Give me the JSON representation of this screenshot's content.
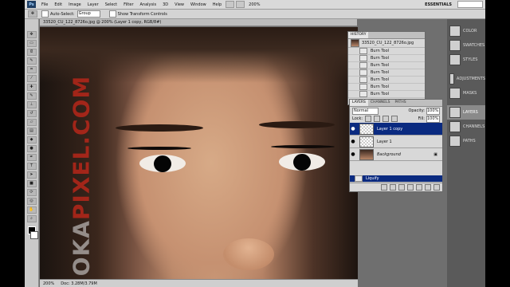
{
  "menubar": {
    "logo": "Ps",
    "items": [
      "File",
      "Edit",
      "Image",
      "Layer",
      "Select",
      "Filter",
      "Analysis",
      "3D",
      "View",
      "Window",
      "Help"
    ],
    "zoom": "200%",
    "workspace": "ESSENTIALS"
  },
  "options": {
    "auto_select_label": "Auto-Select:",
    "auto_select_value": "Group",
    "show_transform_label": "Show Transform Controls"
  },
  "document": {
    "tab_title": "33520_CU_122_8726o.jpg @ 200% (Layer 1 copy, RGB/8#)",
    "watermark_a": "OKA",
    "watermark_b": "PIXEL.COM",
    "status_zoom": "200%",
    "status_doc": "Doc: 3.28M/3.79M"
  },
  "history": {
    "tab_label": "HISTORY",
    "snapshot_label": "33520_CU_122_8726o.jpg",
    "steps": [
      "Burn Tool",
      "Burn Tool",
      "Burn Tool",
      "Burn Tool",
      "Burn Tool",
      "Burn Tool",
      "Burn Tool"
    ],
    "last_step": "Liquify"
  },
  "layers": {
    "tabs": [
      "LAYERS",
      "CHANNELS",
      "PATHS"
    ],
    "blend_mode": "Normal",
    "opacity_label": "Opacity:",
    "opacity_value": "100%",
    "lock_label": "Lock:",
    "fill_label": "Fill:",
    "fill_value": "100%",
    "items": [
      "Layer 1 copy",
      "Layer 1",
      "Background"
    ]
  },
  "dock": {
    "items": [
      "COLOR",
      "SWATCHES",
      "STYLES",
      "ADJUSTMENTS",
      "MASKS",
      "LAYERS",
      "CHANNELS",
      "PATHS"
    ],
    "active": "LAYERS"
  }
}
